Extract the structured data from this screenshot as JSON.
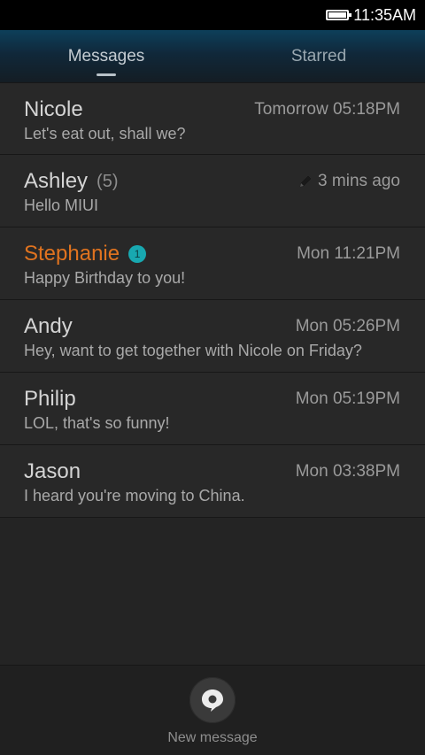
{
  "status_bar": {
    "time": "11:35AM",
    "battery_icon": "battery-full-icon"
  },
  "tabs": [
    {
      "label": "Messages",
      "active": true
    },
    {
      "label": "Starred",
      "active": false
    }
  ],
  "conversations": [
    {
      "name": "Nicole",
      "count": "",
      "unread_badge": "",
      "draft": false,
      "time": "Tomorrow 05:18PM",
      "preview": "Let's eat out, shall we?"
    },
    {
      "name": "Ashley",
      "count": "(5)",
      "unread_badge": "",
      "draft": true,
      "time": "3 mins ago",
      "preview": "Hello MIUI"
    },
    {
      "name": "Stephanie",
      "count": "",
      "unread_badge": "1",
      "draft": false,
      "time": "Mon 11:21PM",
      "preview": "Happy Birthday to you!"
    },
    {
      "name": "Andy",
      "count": "",
      "unread_badge": "",
      "draft": false,
      "time": "Mon 05:26PM",
      "preview": "Hey, want to get together with Nicole on Friday?"
    },
    {
      "name": "Philip",
      "count": "",
      "unread_badge": "",
      "draft": false,
      "time": "Mon 05:19PM",
      "preview": "LOL, that's so funny!"
    },
    {
      "name": "Jason",
      "count": "",
      "unread_badge": "",
      "draft": false,
      "time": "Mon 03:38PM",
      "preview": "I heard you're moving to China."
    }
  ],
  "colors": {
    "unread_name": "#e0731f",
    "badge": "#18a8b0",
    "tab_bar": "#0d3f5a"
  },
  "bottom_bar": {
    "compose_label": "New message",
    "compose_icon": "chat-bubble-icon"
  }
}
